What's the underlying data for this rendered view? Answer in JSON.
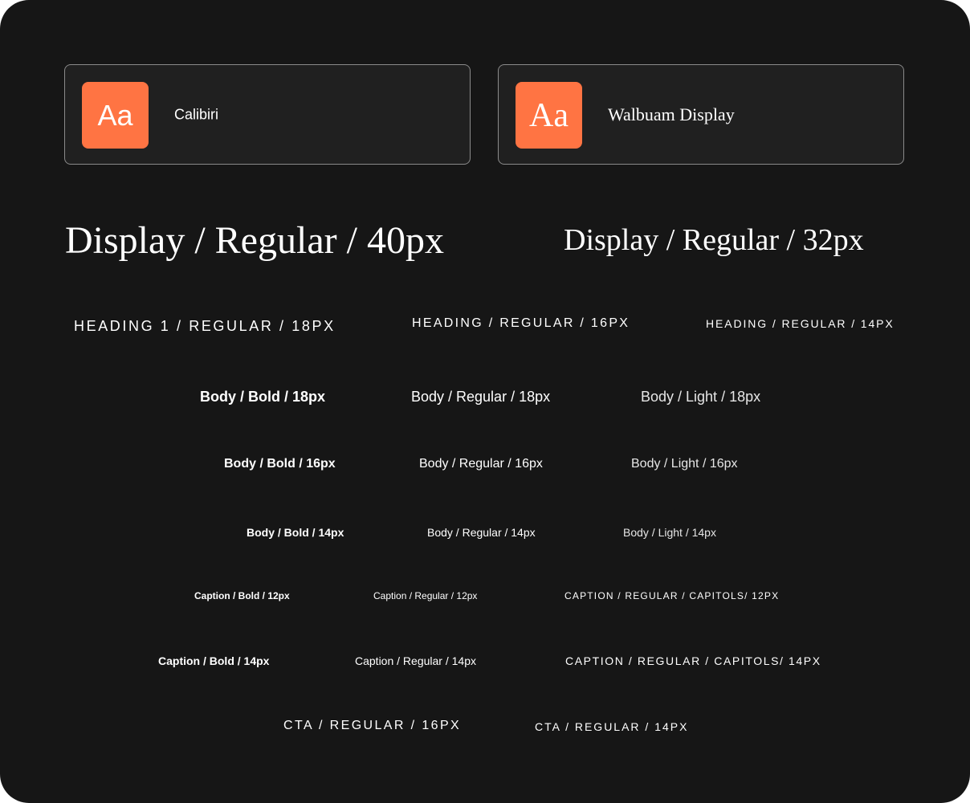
{
  "fonts": [
    {
      "sample": "Aa",
      "name": "Calibiri"
    },
    {
      "sample": "Aa",
      "name": "Walbuam Display"
    }
  ],
  "display": {
    "d40": "Display / Regular / 40px",
    "d32": "Display / Regular / 32px"
  },
  "heading": {
    "h18": "HEADING 1 / REGULAR / 18PX",
    "h16": "HEADING / REGULAR / 16PX",
    "h14": "HEADING / REGULAR / 14PX"
  },
  "body": {
    "bold18": "Body / Bold / 18px",
    "regular18": "Body / Regular / 18px",
    "light18": "Body / Light / 18px",
    "bold16": "Body / Bold / 16px",
    "regular16": "Body / Regular / 16px",
    "light16": "Body / Light / 16px",
    "bold14": "Body / Bold / 14px",
    "regular14": "Body / Regular / 14px",
    "light14": "Body / Light / 14px"
  },
  "caption": {
    "bold12": "Caption / Bold / 12px",
    "regular12": "Caption / Regular / 12px",
    "caps12": "CAPTION / REGULAR / CAPITOLS/ 12PX",
    "bold14": "Caption / Bold / 14px",
    "regular14": "Caption / Regular / 14px",
    "caps14": "CAPTION / REGULAR / CAPITOLS/ 14PX"
  },
  "cta": {
    "r16": "CTA / REGULAR / 16PX",
    "r14": "CTA / REGULAR / 14PX"
  },
  "colors": {
    "background": "#161616",
    "card": "#202020",
    "accent": "#ff7443",
    "text": "#ffffff"
  }
}
